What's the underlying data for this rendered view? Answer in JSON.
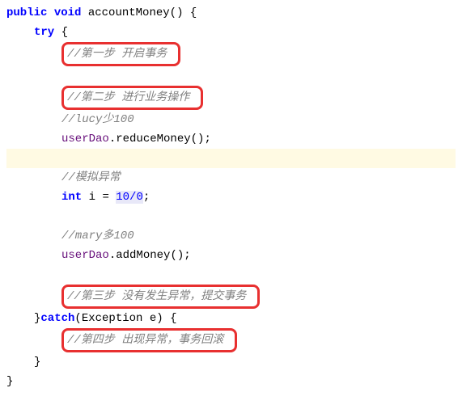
{
  "code": {
    "line1": {
      "kw_public": "public",
      "kw_void": "void",
      "method": "accountMoney",
      "parens": "()",
      "brace": " {"
    },
    "line2": {
      "kw_try": "try",
      "brace": " {"
    },
    "comment1": "//第一步 开启事务",
    "comment2": "//第二步 进行业务操作",
    "comment3": "//lucy少100",
    "line_reduce": {
      "field": "userDao",
      "dot": ".",
      "method": "reduceMoney",
      "tail": "();"
    },
    "comment4": "//模拟异常",
    "line_int": {
      "kw_int": "int",
      "var": " i ",
      "eq": "= ",
      "num": "10/0",
      "semi": ";"
    },
    "comment5": "//mary多100",
    "line_add": {
      "field": "userDao",
      "dot": ".",
      "method": "addMoney",
      "tail": "();"
    },
    "comment6": "//第三步 没有发生异常，提交事务",
    "line_catch": {
      "close_brace": "}",
      "kw_catch": "catch",
      "open_paren": "(",
      "exc_type": "Exception",
      "exc_var": " e",
      "close_paren": ")",
      "brace": " {"
    },
    "comment7": "//第四步 出现异常，事务回滚",
    "close1": "}",
    "close2": "}"
  }
}
